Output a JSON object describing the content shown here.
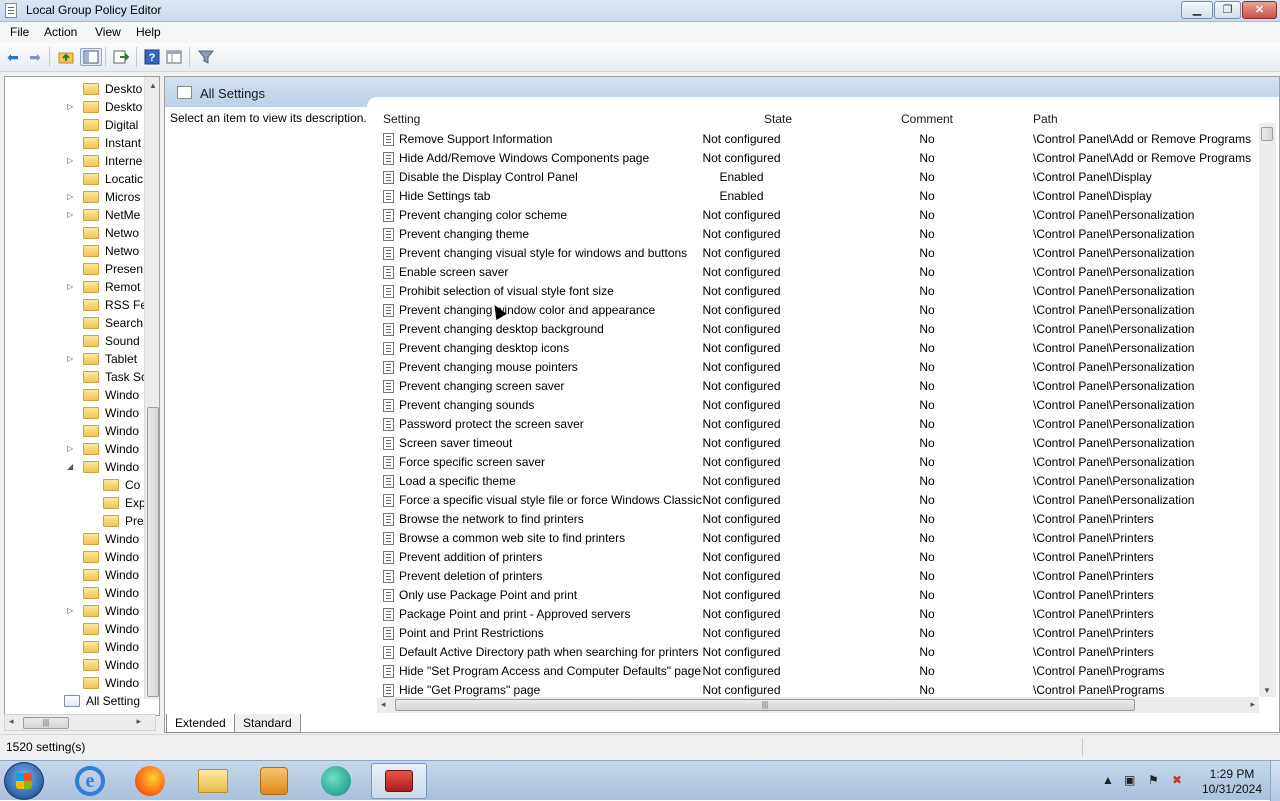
{
  "window": {
    "title": "Local Group Policy Editor",
    "minimize": "▁",
    "maximize": "❐",
    "close": "✕"
  },
  "menu": [
    "File",
    "Action",
    "View",
    "Help"
  ],
  "tree": {
    "items": [
      {
        "label": "Deskto",
        "expander": ""
      },
      {
        "label": "Deskto",
        "expander": "▷"
      },
      {
        "label": "Digital",
        "expander": ""
      },
      {
        "label": "Instant",
        "expander": ""
      },
      {
        "label": "Interne",
        "expander": "▷"
      },
      {
        "label": "Locatic",
        "expander": ""
      },
      {
        "label": "Micros",
        "expander": "▷"
      },
      {
        "label": "NetMe",
        "expander": "▷"
      },
      {
        "label": "Netwo",
        "expander": ""
      },
      {
        "label": "Netwo",
        "expander": ""
      },
      {
        "label": "Presen",
        "expander": ""
      },
      {
        "label": "Remot",
        "expander": "▷"
      },
      {
        "label": "RSS Fe",
        "expander": ""
      },
      {
        "label": "Search",
        "expander": ""
      },
      {
        "label": "Sound",
        "expander": ""
      },
      {
        "label": "Tablet",
        "expander": "▷"
      },
      {
        "label": "Task Sc",
        "expander": ""
      },
      {
        "label": "Windo",
        "expander": ""
      },
      {
        "label": "Windo",
        "expander": ""
      },
      {
        "label": "Windo",
        "expander": ""
      },
      {
        "label": "Windo",
        "expander": "▷"
      },
      {
        "label": "Windo",
        "expander": "◢"
      },
      {
        "label": "Co",
        "expander": "",
        "child": true
      },
      {
        "label": "Exp",
        "expander": "",
        "child": true
      },
      {
        "label": "Pre",
        "expander": "",
        "child": true
      },
      {
        "label": "Windo",
        "expander": ""
      },
      {
        "label": "Windo",
        "expander": ""
      },
      {
        "label": "Windo",
        "expander": ""
      },
      {
        "label": "Windo",
        "expander": ""
      },
      {
        "label": "Windo",
        "expander": "▷"
      },
      {
        "label": "Windo",
        "expander": ""
      },
      {
        "label": "Windo",
        "expander": ""
      },
      {
        "label": "Windo",
        "expander": ""
      },
      {
        "label": "Windo",
        "expander": ""
      },
      {
        "label": "All Setting",
        "expander": "",
        "selected": true
      }
    ]
  },
  "pane": {
    "title": "All Settings",
    "description": "Select an item to view its description."
  },
  "columns": {
    "setting": "Setting",
    "state": "State",
    "comment": "Comment",
    "path": "Path"
  },
  "rows": [
    {
      "name": "Remove Support Information",
      "state": "Not configured",
      "comment": "No",
      "path": "\\Control Panel\\Add or Remove Programs"
    },
    {
      "name": "Hide Add/Remove Windows Components page",
      "state": "Not configured",
      "comment": "No",
      "path": "\\Control Panel\\Add or Remove Programs"
    },
    {
      "name": "Disable the Display Control Panel",
      "state": "Enabled",
      "comment": "No",
      "path": "\\Control Panel\\Display"
    },
    {
      "name": "Hide Settings tab",
      "state": "Enabled",
      "comment": "No",
      "path": "\\Control Panel\\Display"
    },
    {
      "name": "Prevent changing color scheme",
      "state": "Not configured",
      "comment": "No",
      "path": "\\Control Panel\\Personalization"
    },
    {
      "name": "Prevent changing theme",
      "state": "Not configured",
      "comment": "No",
      "path": "\\Control Panel\\Personalization"
    },
    {
      "name": "Prevent changing visual style for windows and buttons",
      "state": "Not configured",
      "comment": "No",
      "path": "\\Control Panel\\Personalization"
    },
    {
      "name": "Enable screen saver",
      "state": "Not configured",
      "comment": "No",
      "path": "\\Control Panel\\Personalization"
    },
    {
      "name": "Prohibit selection of visual style font size",
      "state": "Not configured",
      "comment": "No",
      "path": "\\Control Panel\\Personalization"
    },
    {
      "name": "Prevent changing window color and appearance",
      "state": "Not configured",
      "comment": "No",
      "path": "\\Control Panel\\Personalization"
    },
    {
      "name": "Prevent changing desktop background",
      "state": "Not configured",
      "comment": "No",
      "path": "\\Control Panel\\Personalization"
    },
    {
      "name": "Prevent changing desktop icons",
      "state": "Not configured",
      "comment": "No",
      "path": "\\Control Panel\\Personalization"
    },
    {
      "name": "Prevent changing mouse pointers",
      "state": "Not configured",
      "comment": "No",
      "path": "\\Control Panel\\Personalization"
    },
    {
      "name": "Prevent changing screen saver",
      "state": "Not configured",
      "comment": "No",
      "path": "\\Control Panel\\Personalization"
    },
    {
      "name": "Prevent changing sounds",
      "state": "Not configured",
      "comment": "No",
      "path": "\\Control Panel\\Personalization"
    },
    {
      "name": "Password protect the screen saver",
      "state": "Not configured",
      "comment": "No",
      "path": "\\Control Panel\\Personalization"
    },
    {
      "name": "Screen saver timeout",
      "state": "Not configured",
      "comment": "No",
      "path": "\\Control Panel\\Personalization"
    },
    {
      "name": "Force specific screen saver",
      "state": "Not configured",
      "comment": "No",
      "path": "\\Control Panel\\Personalization"
    },
    {
      "name": "Load a specific theme",
      "state": "Not configured",
      "comment": "No",
      "path": "\\Control Panel\\Personalization"
    },
    {
      "name": "Force a specific visual style file or force Windows Classic",
      "state": "Not configured",
      "comment": "No",
      "path": "\\Control Panel\\Personalization"
    },
    {
      "name": "Browse the network to find printers",
      "state": "Not configured",
      "comment": "No",
      "path": "\\Control Panel\\Printers"
    },
    {
      "name": "Browse a common web site to find printers",
      "state": "Not configured",
      "comment": "No",
      "path": "\\Control Panel\\Printers"
    },
    {
      "name": "Prevent addition of printers",
      "state": "Not configured",
      "comment": "No",
      "path": "\\Control Panel\\Printers"
    },
    {
      "name": "Prevent deletion of printers",
      "state": "Not configured",
      "comment": "No",
      "path": "\\Control Panel\\Printers"
    },
    {
      "name": "Only use Package Point and print",
      "state": "Not configured",
      "comment": "No",
      "path": "\\Control Panel\\Printers"
    },
    {
      "name": "Package Point and print - Approved servers",
      "state": "Not configured",
      "comment": "No",
      "path": "\\Control Panel\\Printers"
    },
    {
      "name": "Point and Print Restrictions",
      "state": "Not configured",
      "comment": "No",
      "path": "\\Control Panel\\Printers"
    },
    {
      "name": "Default Active Directory path when searching for printers",
      "state": "Not configured",
      "comment": "No",
      "path": "\\Control Panel\\Printers"
    },
    {
      "name": "Hide \"Set Program Access and Computer Defaults\" page",
      "state": "Not configured",
      "comment": "No",
      "path": "\\Control Panel\\Programs"
    },
    {
      "name": "Hide \"Get Programs\" page",
      "state": "Not configured",
      "comment": "No",
      "path": "\\Control Panel\\Programs"
    }
  ],
  "tabs": {
    "extended": "Extended",
    "standard": "Standard"
  },
  "status": {
    "text": "1520 setting(s)"
  },
  "taskbar": {
    "time": "1:29 PM",
    "date": "10/31/2024",
    "apps": [
      "internet-explorer-icon",
      "firefox-icon",
      "file-explorer-icon",
      "media-player-icon",
      "chat-app-icon",
      "group-policy-icon"
    ]
  }
}
